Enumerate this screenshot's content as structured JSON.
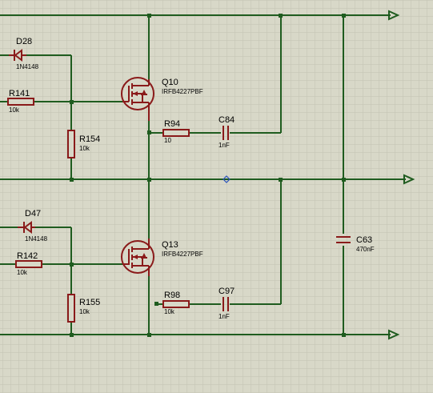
{
  "components": {
    "d28": {
      "ref": "D28",
      "value": "1N4148"
    },
    "r141": {
      "ref": "R141",
      "value": "10k"
    },
    "q10": {
      "ref": "Q10",
      "value": "IRFB4227PBF"
    },
    "r154": {
      "ref": "R154",
      "value": "10k"
    },
    "r94": {
      "ref": "R94",
      "value": "10"
    },
    "c84": {
      "ref": "C84",
      "value": "1nF"
    },
    "d47": {
      "ref": "D47",
      "value": "1N4148"
    },
    "r142": {
      "ref": "R142",
      "value": "10k"
    },
    "q13": {
      "ref": "Q13",
      "value": "IRFB4227PBF"
    },
    "r155": {
      "ref": "R155",
      "value": "10k"
    },
    "r98": {
      "ref": "R98",
      "value": "10k"
    },
    "c97": {
      "ref": "C97",
      "value": "1nF"
    },
    "c63": {
      "ref": "C63",
      "value": "470nF"
    }
  },
  "colors": {
    "background": "#d8d8c8",
    "grid": "#c2c2b2",
    "wire": "#1f5c1f",
    "component": "#8a1a1a",
    "marker": "#2a52be"
  }
}
